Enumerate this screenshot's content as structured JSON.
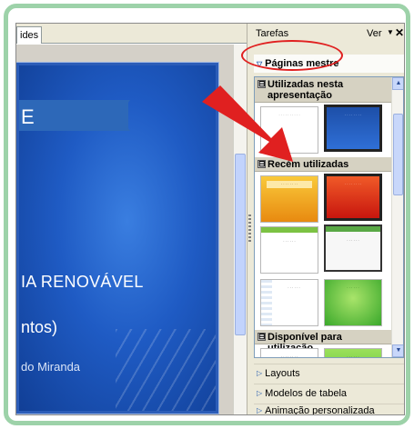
{
  "editor": {
    "tab_label": "ides",
    "slide": {
      "title_fragment": "E",
      "line1": "IA RENOVÁVEL",
      "line2": "ntos)",
      "line3": "do Miranda"
    }
  },
  "task_pane": {
    "title": "Tarefas",
    "view_label": "Ver",
    "caret_icon": "chevron-down-icon",
    "close_label": "✕",
    "master_pages": {
      "label": "Páginas mestre",
      "groups": [
        {
          "label": "Utilizadas nesta apresentação",
          "collapse": "⊟"
        },
        {
          "label": "Recém utilizadas",
          "collapse": "⊟"
        },
        {
          "label": "Disponível para utilização",
          "collapse": "⊟"
        }
      ]
    },
    "bottom_sections": [
      {
        "label": "Layouts"
      },
      {
        "label": "Modelos de tabela"
      },
      {
        "label": "Animação personalizada"
      }
    ]
  },
  "annotation": {
    "highlight_color": "#e02020"
  },
  "colors": {
    "frame": "#9dd2a9",
    "slide_blue": "#1f5bc4"
  }
}
